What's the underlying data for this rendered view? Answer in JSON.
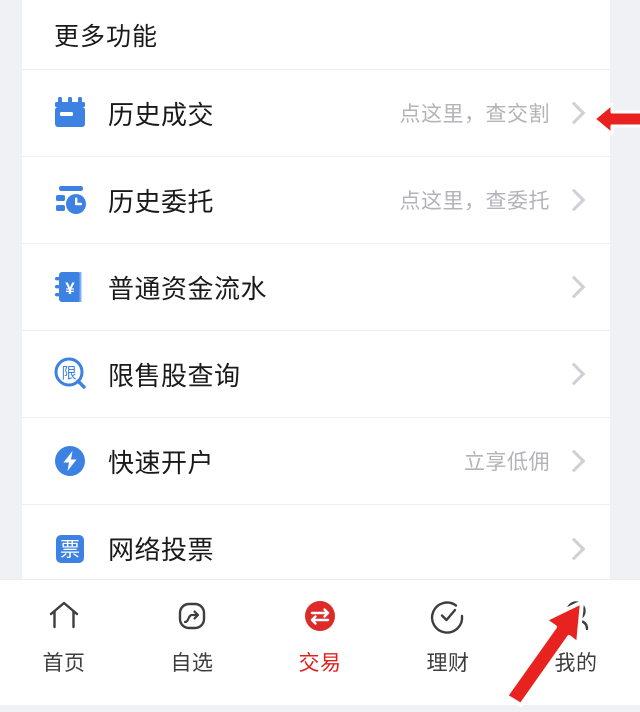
{
  "card": {
    "header_title": "更多功能",
    "rows": [
      {
        "icon": "calendar-icon",
        "label": "历史成交",
        "hint": "点这里，查交割"
      },
      {
        "icon": "list-clock-icon",
        "label": "历史委托",
        "hint": "点这里，查委托"
      },
      {
        "icon": "notebook-yuan-icon",
        "label": "普通资金流水",
        "hint": ""
      },
      {
        "icon": "magnifier-xian-icon",
        "label": "限售股查询",
        "hint": ""
      },
      {
        "icon": "lightning-icon",
        "label": "快速开户",
        "hint": "立享低佣"
      },
      {
        "icon": "vote-icon",
        "label": "网络投票",
        "hint": ""
      }
    ],
    "chevron_icon": "chevron-right-icon"
  },
  "tabbar": {
    "items": [
      {
        "icon": "home-icon",
        "label": "首页",
        "active": false
      },
      {
        "icon": "watchlist-icon",
        "label": "自选",
        "active": false
      },
      {
        "icon": "trade-icon",
        "label": "交易",
        "active": true
      },
      {
        "icon": "finance-icon",
        "label": "理财",
        "active": false
      },
      {
        "icon": "profile-icon",
        "label": "我的",
        "active": false
      }
    ]
  },
  "annotations": [
    {
      "name": "arrow-pointing-to-history-trades-row",
      "direction": "left"
    },
    {
      "name": "arrow-pointing-to-profile-tab",
      "direction": "up-right"
    }
  ],
  "colors": {
    "icon_blue": "#3d82e3",
    "accent_red": "#e02020",
    "annotation_red": "#e8231f",
    "page_background": "#f0f1f5",
    "hint_gray": "#b3b3b8",
    "chevron_gray": "#cfcfd4"
  }
}
